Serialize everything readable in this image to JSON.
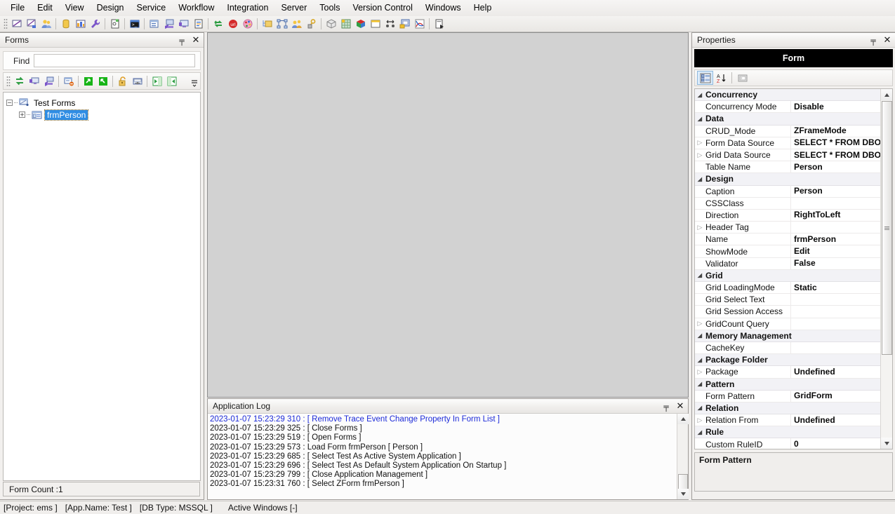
{
  "menu": {
    "items": [
      {
        "label": "File"
      },
      {
        "label": "Edit"
      },
      {
        "label": "View"
      },
      {
        "label": "Design"
      },
      {
        "label": "Service"
      },
      {
        "label": "Workflow"
      },
      {
        "label": "Integration"
      },
      {
        "label": "Server"
      },
      {
        "label": "Tools"
      },
      {
        "label": "Version Control"
      },
      {
        "label": "Windows"
      },
      {
        "label": "Help"
      }
    ]
  },
  "toolbar": {
    "groups": [
      [
        "new-diagram-icon",
        "open-diagram-icon",
        "users-icon"
      ],
      [
        "database-icon",
        "report-icon",
        "wrench-icon"
      ],
      [
        "script-icon"
      ],
      [
        "console-icon"
      ],
      [
        "form-window-icon",
        "deploy-icon",
        "monitor-icon",
        "document-icon"
      ],
      [
        "sync-icon",
        "url-icon",
        "palette-icon"
      ],
      [
        "folder-tree-icon",
        "hierarchy-icon",
        "user-group-icon",
        "key-lock-icon"
      ],
      [
        "package-icon",
        "grid-color-icon",
        "cube-icon",
        "window-icon",
        "align-icon",
        "export-icon",
        "chart-icon"
      ],
      [
        "run-debug-icon"
      ]
    ]
  },
  "forms_panel": {
    "title": "Forms",
    "pin_glyph": "╤",
    "close_glyph": "✕",
    "find_label": "Find",
    "find_value": "",
    "find_placeholder": "",
    "toolbar_icons": [
      "refresh-icon",
      "monitor-sync-icon",
      "deploy-form-icon",
      "remove-form-icon",
      "export-green-icon",
      "import-green-icon",
      "unlock-icon",
      "lock-link-icon",
      "collapse-left-icon",
      "expand-right-icon"
    ],
    "overflow_glyph": "≡",
    "tree": {
      "root": {
        "label": "Test Forms",
        "expander": "−",
        "icon": "forms-root-icon"
      },
      "child": {
        "label": "frmPerson",
        "expander": "+",
        "icon": "form-item-icon",
        "selected": true
      }
    },
    "form_count": "Form Count :1"
  },
  "log_panel": {
    "title": "Application Log",
    "pin_glyph": "╤",
    "close_glyph": "✕",
    "lines": [
      {
        "text": "2023-01-07 15:23:29 310 :  [  Remove Trace Event Change Property In Form List   ]",
        "color": "blue"
      },
      {
        "text": "2023-01-07 15:23:29 325 :  [ Close Forms ]",
        "color": "black"
      },
      {
        "text": "2023-01-07 15:23:29 519 :  [ Open Forms ]",
        "color": "black"
      },
      {
        "text": "2023-01-07 15:23:29 573 :  Load Form frmPerson [ Person ]",
        "color": "black"
      },
      {
        "text": "2023-01-07 15:23:29 685 :  [ Select Test As Active System Application ]",
        "color": "black"
      },
      {
        "text": "2023-01-07 15:23:29 696 :  [ Select Test As Default System Application On Startup ]",
        "color": "black"
      },
      {
        "text": "2023-01-07 15:23:29 799 :  [ Close Application Management ]",
        "color": "black"
      },
      {
        "text": "2023-01-07 15:23:31 760 :  [ Select ZForm frmPerson ]",
        "color": "black"
      }
    ],
    "scroll_up_glyph": "▲",
    "scroll_down_glyph": "▼"
  },
  "properties_panel": {
    "title": "Properties",
    "pin_glyph": "╤",
    "close_glyph": "✕",
    "header_label": "Form",
    "toolbar_icons": [
      "categorized-icon",
      "alphabetical-sort-icon",
      "property-pages-icon"
    ],
    "scroll_up_glyph": "▲",
    "scroll_down_glyph": "▼",
    "rows": [
      {
        "kind": "category",
        "name": "Concurrency",
        "value": "",
        "expander": "◢"
      },
      {
        "kind": "prop",
        "name": "Concurrency Mode",
        "value": "Disable",
        "expander": ""
      },
      {
        "kind": "category",
        "name": "Data",
        "value": "",
        "expander": "◢"
      },
      {
        "kind": "prop",
        "name": "CRUD_Mode",
        "value": "ZFrameMode",
        "expander": ""
      },
      {
        "kind": "prop",
        "name": "Form Data Source",
        "value": "SELECT * FROM  DBO.PE",
        "expander": "▷"
      },
      {
        "kind": "prop",
        "name": "Grid Data Source",
        "value": "SELECT * FROM  DBO.PE",
        "expander": "▷"
      },
      {
        "kind": "prop",
        "name": "Table Name",
        "value": "Person",
        "expander": ""
      },
      {
        "kind": "category",
        "name": "Design",
        "value": "",
        "expander": "◢"
      },
      {
        "kind": "prop",
        "name": "Caption",
        "value": "Person",
        "expander": ""
      },
      {
        "kind": "prop",
        "name": "CSSClass",
        "value": "",
        "expander": ""
      },
      {
        "kind": "prop",
        "name": "Direction",
        "value": "RightToLeft",
        "expander": ""
      },
      {
        "kind": "prop",
        "name": "Header Tag",
        "value": "",
        "expander": "▷"
      },
      {
        "kind": "prop",
        "name": "Name",
        "value": "frmPerson",
        "expander": ""
      },
      {
        "kind": "prop",
        "name": "ShowMode",
        "value": "Edit",
        "expander": ""
      },
      {
        "kind": "prop",
        "name": "Validator",
        "value": "False",
        "expander": ""
      },
      {
        "kind": "category",
        "name": "Grid",
        "value": "",
        "expander": "◢"
      },
      {
        "kind": "prop",
        "name": "Grid LoadingMode",
        "value": "Static",
        "expander": ""
      },
      {
        "kind": "prop",
        "name": "Grid Select Text",
        "value": "",
        "expander": ""
      },
      {
        "kind": "prop",
        "name": "Grid Session Access",
        "value": "",
        "expander": ""
      },
      {
        "kind": "prop",
        "name": "GridCount Query",
        "value": "",
        "expander": "▷"
      },
      {
        "kind": "category",
        "name": "Memory Management",
        "value": "",
        "expander": "◢"
      },
      {
        "kind": "prop",
        "name": "CacheKey",
        "value": "",
        "expander": ""
      },
      {
        "kind": "category",
        "name": "Package Folder",
        "value": "",
        "expander": "◢"
      },
      {
        "kind": "prop",
        "name": "Package",
        "value": "Undefined",
        "expander": "▷"
      },
      {
        "kind": "category",
        "name": "Pattern",
        "value": "",
        "expander": "◢"
      },
      {
        "kind": "prop",
        "name": "Form Pattern",
        "value": "GridForm",
        "expander": ""
      },
      {
        "kind": "category",
        "name": "Relation",
        "value": "",
        "expander": "◢"
      },
      {
        "kind": "prop",
        "name": "Relation From",
        "value": "Undefined",
        "expander": "▷"
      },
      {
        "kind": "category",
        "name": "Rule",
        "value": "",
        "expander": "◢"
      },
      {
        "kind": "prop",
        "name": "Custom RuleID",
        "value": "0",
        "expander": ""
      }
    ],
    "description": {
      "title": "Form Pattern",
      "text": ""
    }
  },
  "statusbar": {
    "project": "[Project: ems ]",
    "app_name": "[App.Name: Test ]",
    "db_type": "[DB Type: MSSQL ]",
    "active_windows": "Active Windows [-]"
  },
  "colors": {
    "selection_blue": "#2f8de4",
    "log_blue": "#1c2ad8",
    "panel_bg": "#f2f0ee",
    "editor_bg": "#d2d2d2",
    "header_black": "#000000"
  }
}
